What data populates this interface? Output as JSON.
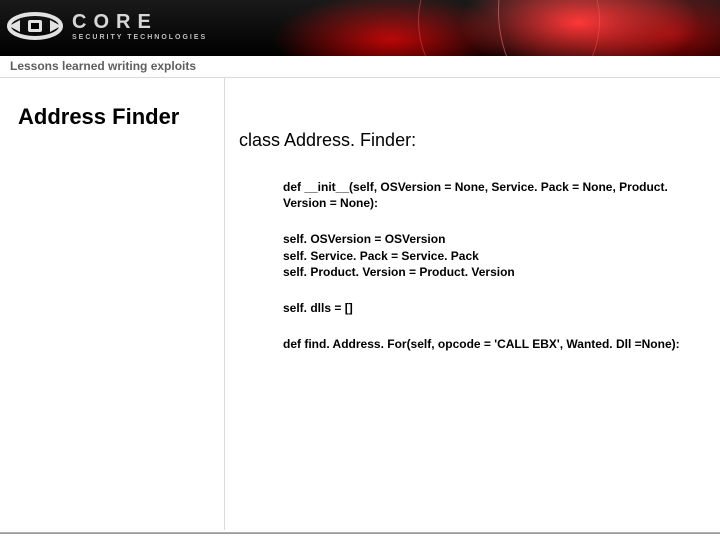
{
  "brand": {
    "name": "CORE",
    "tagline": "SECURITY TECHNOLOGIES"
  },
  "subheader": "Lessons learned writing exploits",
  "title": "Address Finder",
  "class_header": "class Address. Finder:",
  "code": {
    "init_sig": "def __init__(self, OSVersion = None, Service. Pack = None, Product. Version = None):",
    "assign1": "self. OSVersion      = OSVersion",
    "assign2": " self. Service. Pack    = Service. Pack",
    "assign3": " self. Product. Version = Product. Version",
    "dlls": " self. dlls = []",
    "find_sig": "def find. Address. For(self, opcode = 'CALL EBX', Wanted. Dll =None):"
  }
}
